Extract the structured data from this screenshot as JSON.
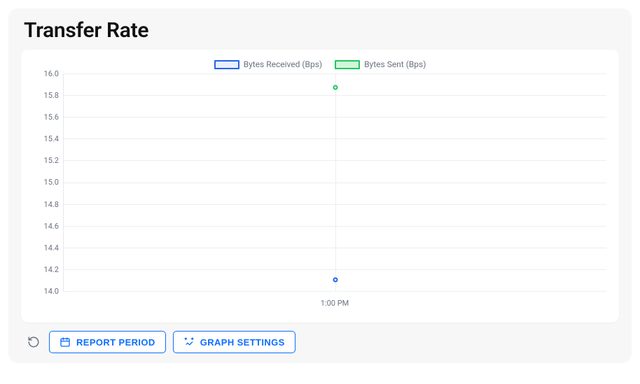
{
  "title": "Transfer Rate",
  "legend": {
    "items": [
      {
        "label": "Bytes Received (Bps)",
        "stroke": "#2563eb",
        "fill": "#e8f0ff"
      },
      {
        "label": "Bytes Sent (Bps)",
        "stroke": "#22c55e",
        "fill": "#d1f7db"
      }
    ]
  },
  "yticks": [
    "16.0",
    "15.8",
    "15.6",
    "15.4",
    "15.2",
    "15.0",
    "14.8",
    "14.6",
    "14.4",
    "14.2",
    "14.0"
  ],
  "xticks": [
    {
      "label": "1:00 PM",
      "pos": 0.5
    }
  ],
  "buttons": {
    "report_period": "REPORT PERIOD",
    "graph_settings": "GRAPH SETTINGS"
  },
  "chart_data": {
    "type": "line",
    "title": "Transfer Rate",
    "xlabel": "",
    "ylabel": "",
    "ylim": [
      14.0,
      16.0
    ],
    "x": [
      "1:00 PM"
    ],
    "series": [
      {
        "name": "Bytes Received (Bps)",
        "values": [
          14.1
        ],
        "color": "#2563eb"
      },
      {
        "name": "Bytes Sent (Bps)",
        "values": [
          15.87
        ],
        "color": "#22c55e"
      }
    ],
    "grid": true,
    "legend_position": "top"
  }
}
